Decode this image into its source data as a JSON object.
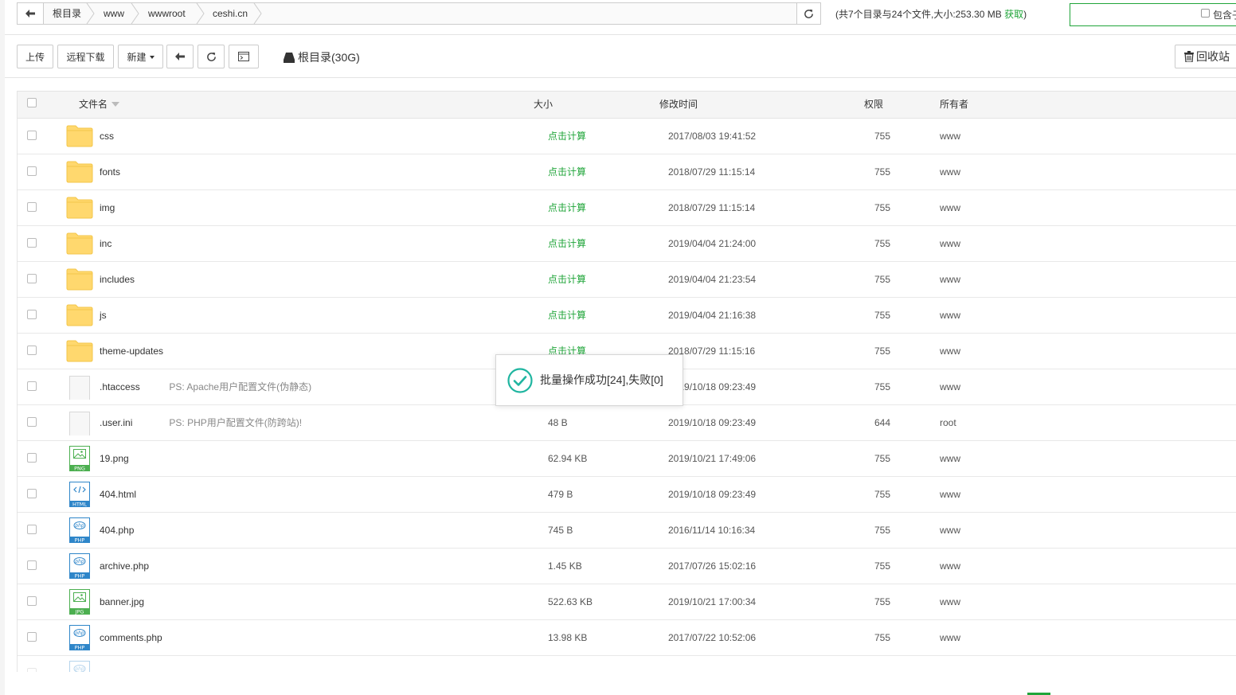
{
  "path_bar": {
    "crumbs": [
      "根目录",
      "www",
      "wwwroot",
      "ceshi.cn"
    ]
  },
  "summary": {
    "text": "(共7个目录与24个文件,大小:253.30 MB",
    "link": "获取",
    "close": ")"
  },
  "search": {
    "placeholder": "",
    "include_sub_label": "包含子目录"
  },
  "toolbar": {
    "upload": "上传",
    "remote_download": "远程下载",
    "new": "新建",
    "disk": "根目录(30G)",
    "recycle_bin": "回收站"
  },
  "table": {
    "columns": {
      "name": "文件名",
      "size": "大小",
      "modified": "修改时间",
      "permission": "权限",
      "owner": "所有者"
    },
    "rows": [
      {
        "type": "folder",
        "name": "css",
        "ps": "",
        "size": "点击计算",
        "time": "2017/08/03 19:41:52",
        "perm": "755",
        "owner": "www"
      },
      {
        "type": "folder",
        "name": "fonts",
        "ps": "",
        "size": "点击计算",
        "time": "2018/07/29 11:15:14",
        "perm": "755",
        "owner": "www"
      },
      {
        "type": "folder",
        "name": "img",
        "ps": "",
        "size": "点击计算",
        "time": "2018/07/29 11:15:14",
        "perm": "755",
        "owner": "www"
      },
      {
        "type": "folder",
        "name": "inc",
        "ps": "",
        "size": "点击计算",
        "time": "2019/04/04 21:24:00",
        "perm": "755",
        "owner": "www"
      },
      {
        "type": "folder",
        "name": "includes",
        "ps": "",
        "size": "点击计算",
        "time": "2019/04/04 21:23:54",
        "perm": "755",
        "owner": "www"
      },
      {
        "type": "folder",
        "name": "js",
        "ps": "",
        "size": "点击计算",
        "time": "2019/04/04 21:16:38",
        "perm": "755",
        "owner": "www"
      },
      {
        "type": "folder",
        "name": "theme-updates",
        "ps": "",
        "size": "点击计算",
        "time": "2018/07/29 11:15:16",
        "perm": "755",
        "owner": "www"
      },
      {
        "type": "blank",
        "name": ".htaccess",
        "ps": "PS: Apache用户配置文件(伪静态)",
        "size": "",
        "time": "2019/10/18 09:23:49",
        "perm": "755",
        "owner": "www"
      },
      {
        "type": "blank",
        "name": ".user.ini",
        "ps": "PS: PHP用户配置文件(防跨站)!",
        "size": "48 B",
        "time": "2019/10/18 09:23:49",
        "perm": "644",
        "owner": "root"
      },
      {
        "type": "png",
        "name": "19.png",
        "ps": "",
        "size": "62.94 KB",
        "time": "2019/10/21 17:49:06",
        "perm": "755",
        "owner": "www"
      },
      {
        "type": "html",
        "name": "404.html",
        "ps": "",
        "size": "479 B",
        "time": "2019/10/18 09:23:49",
        "perm": "755",
        "owner": "www"
      },
      {
        "type": "php",
        "name": "404.php",
        "ps": "",
        "size": "745 B",
        "time": "2016/11/14 10:16:34",
        "perm": "755",
        "owner": "www"
      },
      {
        "type": "php",
        "name": "archive.php",
        "ps": "",
        "size": "1.45 KB",
        "time": "2017/07/26 15:02:16",
        "perm": "755",
        "owner": "www"
      },
      {
        "type": "jpg",
        "name": "banner.jpg",
        "ps": "",
        "size": "522.63 KB",
        "time": "2019/10/21 17:00:34",
        "perm": "755",
        "owner": "www"
      },
      {
        "type": "php",
        "name": "comments.php",
        "ps": "",
        "size": "13.98 KB",
        "time": "2017/07/22 10:52:06",
        "perm": "755",
        "owner": "www"
      },
      {
        "type": "php",
        "name": "",
        "ps": "",
        "size": "",
        "time": "",
        "perm": "",
        "owner": "",
        "partial": true
      }
    ]
  },
  "toast": {
    "message": "批量操作成功[24],失败[0]"
  },
  "icon_labels": {
    "png": "PNG",
    "html": "HTML",
    "php": "PHP",
    "jpg": "JPG",
    "php_logo": "php"
  },
  "colors": {
    "accent_green": "#20a53a",
    "folder": "#ffd86e",
    "png_icon": "#4caf50",
    "html_icon": "#2f86c9",
    "php_icon": "#2f86c9",
    "toast_check": "#1fb5a0"
  }
}
